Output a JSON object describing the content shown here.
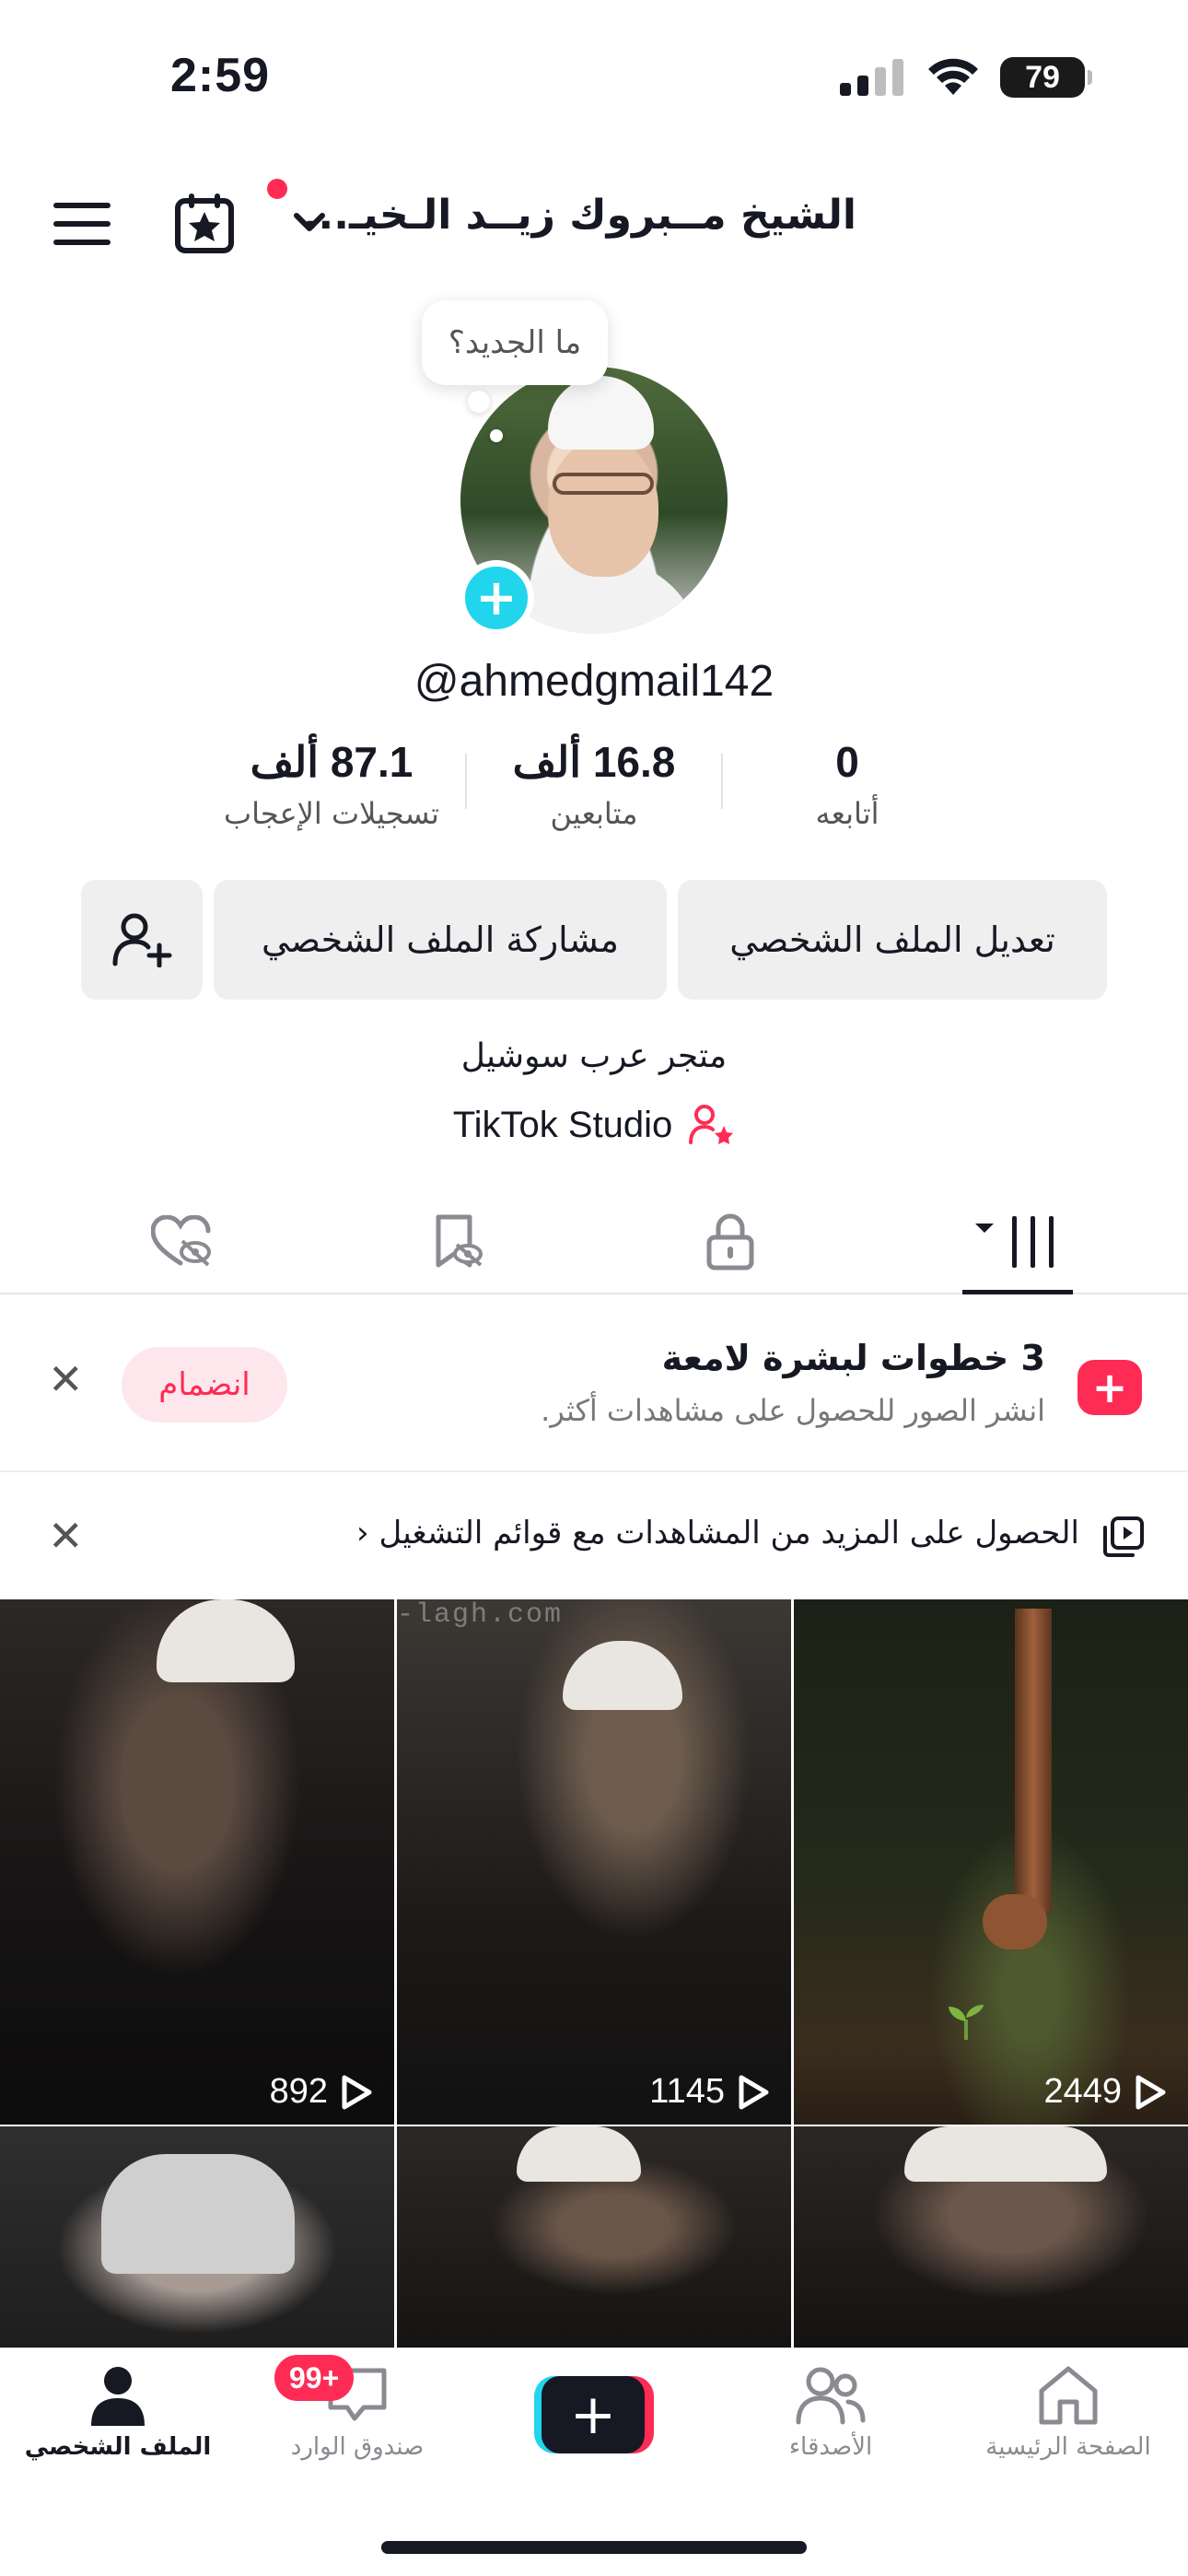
{
  "status_bar": {
    "time": "2:59",
    "battery": "79"
  },
  "header": {
    "title": "الشيخ مــبروك زيــد الـخيـ..."
  },
  "profile": {
    "bubble_text": "ما الجديد؟",
    "username": "@ahmedgmail142",
    "stats": [
      {
        "value": "0",
        "label": "أتابعه"
      },
      {
        "value": "16.8 ألف",
        "label": "متابعين"
      },
      {
        "value": "87.1 ألف",
        "label": "تسجيلات الإعجاب"
      }
    ],
    "buttons": {
      "edit": "تعديل الملف الشخصي",
      "share": "مشاركة الملف الشخصي"
    },
    "bio": "متجر عرب سوشيل",
    "studio": "TikTok Studio"
  },
  "banners": {
    "steps_title": "3 خطوات لبشرة لامعة",
    "steps_sub": "انشر الصور للحصول على مشاهدات أكثر.",
    "join": "انضمام",
    "playlist": "الحصول على المزيد من المشاهدات مع قوائم التشغيل",
    "playlist_chevron": "‹"
  },
  "videos": [
    {
      "views": "2449"
    },
    {
      "views": "1145",
      "watermark": "-lagh.com"
    },
    {
      "views": "892"
    },
    {
      "views": ""
    },
    {
      "views": ""
    },
    {
      "views": ""
    }
  ],
  "bottom_nav": {
    "home": "الصفحة الرئيسية",
    "friends": "الأصدقاء",
    "create": "+",
    "inbox": "صندوق الوارد",
    "inbox_badge": "99+",
    "profile": "الملف الشخصي"
  },
  "colors": {
    "accent": "#fe2c55",
    "cyan": "#20d5ec",
    "text": "#161823"
  }
}
